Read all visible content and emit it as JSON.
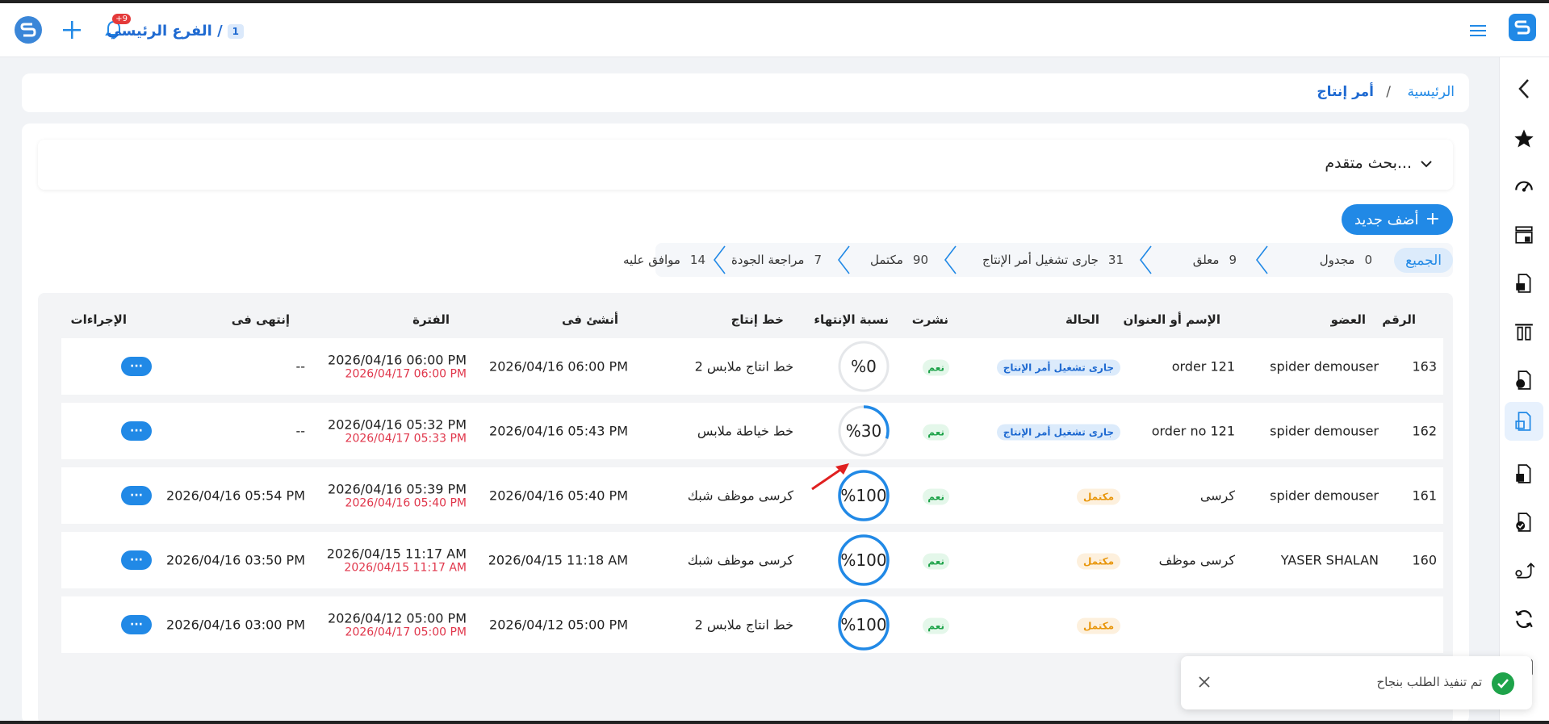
{
  "topbar": {
    "branch_number": "1",
    "branch_name": "الفرع الرئيسي /",
    "notification_badge": "+9"
  },
  "breadcrumb": {
    "home": "الرئيسية",
    "separator": "/",
    "current": "أمر إنتاج"
  },
  "search": {
    "advanced_label": "بحث متقدم..."
  },
  "actions": {
    "add_new": "أضف جديد"
  },
  "tabs": {
    "all": "الجميع",
    "items": [
      {
        "label": "مجدول",
        "count": "0"
      },
      {
        "label": "معلق",
        "count": "9"
      },
      {
        "label": "جارى تشغيل أمر الإنتاج",
        "count": "31"
      },
      {
        "label": "مكتمل",
        "count": "90"
      },
      {
        "label": "مراجعة الجودة",
        "count": "7"
      },
      {
        "label": "موافق عليه",
        "count": "14"
      }
    ]
  },
  "table": {
    "headers": {
      "number": "الرقم",
      "member": "العضو",
      "name": "الإسم أو العنوان",
      "status": "الحالة",
      "published": "نشرت",
      "completion": "نسبة الإنتهاء",
      "line": "خط إنتاج",
      "created": "أنشئ فى",
      "period": "الفترة",
      "ended": "إنتهى فى",
      "actions": "الإجراءات"
    },
    "rows": [
      {
        "number": "163",
        "member": "spider demouser",
        "name": "order 121",
        "status": "جارى تشغيل أمر الإنتاج",
        "status_type": "running",
        "published": "نعم",
        "completion": 0,
        "completion_label": "%0",
        "line": "خط انتاج ملابس 2",
        "created": "2026/04/16 06:00 PM",
        "period_start": "2026/04/16 06:00 PM",
        "period_end": "2026/04/17 06:00 PM",
        "ended": "--",
        "action": "···"
      },
      {
        "number": "162",
        "member": "spider demouser",
        "name": "order no 121",
        "status": "جارى تشغيل أمر الإنتاج",
        "status_type": "running",
        "published": "نعم",
        "completion": 30,
        "completion_label": "%30",
        "line": "خط خياطة ملابس",
        "created": "2026/04/16 05:43 PM",
        "period_start": "2026/04/16 05:32 PM",
        "period_end": "2026/04/17 05:33 PM",
        "ended": "--",
        "action": "···"
      },
      {
        "number": "161",
        "member": "spider demouser",
        "name": "كرسى",
        "status": "مكتمل",
        "status_type": "done",
        "published": "نعم",
        "completion": 100,
        "completion_label": "%100",
        "line": "كرسى موظف شبك",
        "created": "2026/04/16 05:40 PM",
        "period_start": "2026/04/16 05:39 PM",
        "period_end": "2026/04/16 05:40 PM",
        "ended": "2026/04/16 05:54 PM",
        "action": "···"
      },
      {
        "number": "160",
        "member": "YASER SHALAN",
        "name": "كرسى موظف",
        "status": "مكتمل",
        "status_type": "done",
        "published": "نعم",
        "completion": 100,
        "completion_label": "%100",
        "line": "كرسى موظف شبك",
        "created": "2026/04/15 11:18 AM",
        "period_start": "2026/04/15 11:17 AM",
        "period_end": "2026/04/15 11:17 AM",
        "ended": "2026/04/16 03:50 PM",
        "action": "···"
      },
      {
        "number": "",
        "member": "",
        "name": "",
        "status": "مكتمل",
        "status_type": "done",
        "published": "نعم",
        "completion": 100,
        "completion_label": "%100",
        "line": "خط انتاج ملابس 2",
        "created": "2026/04/12 05:00 PM",
        "period_start": "2026/04/12 05:00 PM",
        "period_end": "2026/04/17 05:00 PM",
        "ended": "2026/04/16 03:00 PM",
        "action": "···"
      }
    ]
  },
  "toast": {
    "message": "تم تنفيذ الطلب بنجاح"
  },
  "colors": {
    "accent": "#2189e6",
    "danger": "#e0364b",
    "success": "#1ea34a",
    "warning": "#e8960b"
  },
  "icons": [
    "menu-icon",
    "app-logo-icon",
    "plus-icon",
    "bell-icon",
    "chevron-left-icon",
    "star-icon",
    "dashboard-icon",
    "store-icon",
    "document-icon",
    "columns-icon",
    "file-icon",
    "package-icon",
    "transfer-icon",
    "refresh-icon",
    "check-circle-icon",
    "close-icon",
    "chevron-down-icon"
  ]
}
